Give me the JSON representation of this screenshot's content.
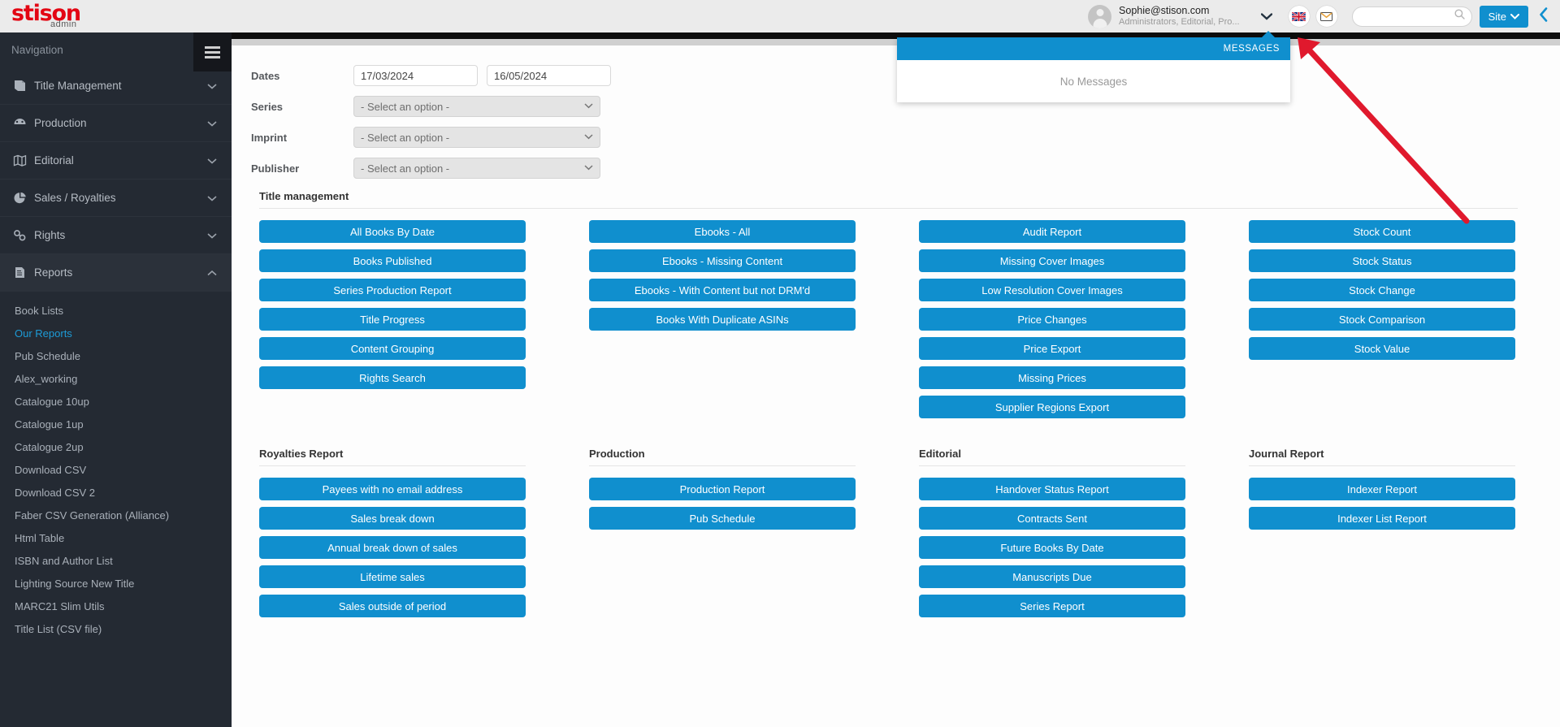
{
  "brand": {
    "name": "stison",
    "sub": "admin"
  },
  "header": {
    "user_email": "Sophie@stison.com",
    "user_roles": "Administrators, Editorial, Pro...",
    "user_chevron": "❯",
    "language_icon": "uk-flag-icon",
    "messages_icon": "envelope-icon",
    "search_placeholder": "",
    "search_value": "",
    "search_icon": "search-icon",
    "site_label": "Site",
    "site_chevron": "❯",
    "collapse_chevron": "❮",
    "accent_color": "#108fce",
    "brand_color": "#e30613"
  },
  "messages_popup": {
    "title": "MESSAGES",
    "empty_text": "No Messages"
  },
  "sidebar": {
    "heading": "Navigation",
    "menu_icon": "hamburger-icon",
    "items": [
      {
        "label": "Title Management",
        "icon": "book-icon",
        "arrow": "⌄"
      },
      {
        "label": "Production",
        "icon": "gauge-icon",
        "arrow": "⌄"
      },
      {
        "label": "Editorial",
        "icon": "map-icon",
        "arrow": "⌄"
      },
      {
        "label": "Sales / Royalties",
        "icon": "pie-chart-icon",
        "arrow": "⌄"
      },
      {
        "label": "Rights",
        "icon": "link-icon",
        "arrow": "⌄"
      },
      {
        "label": "Reports",
        "icon": "document-icon",
        "arrow": "⌃"
      }
    ],
    "sub_items": [
      {
        "label": "Book Lists",
        "selected": false
      },
      {
        "label": "Our Reports",
        "selected": true
      },
      {
        "label": "Pub Schedule",
        "selected": false
      },
      {
        "label": "Alex_working",
        "selected": false
      },
      {
        "label": "Catalogue 10up",
        "selected": false
      },
      {
        "label": "Catalogue 1up",
        "selected": false
      },
      {
        "label": "Catalogue 2up",
        "selected": false
      },
      {
        "label": "Download CSV",
        "selected": false
      },
      {
        "label": "Download CSV 2",
        "selected": false
      },
      {
        "label": "Faber CSV Generation (Alliance)",
        "selected": false
      },
      {
        "label": "Html Table",
        "selected": false
      },
      {
        "label": "ISBN and Author List",
        "selected": false
      },
      {
        "label": "Lighting Source New Title",
        "selected": false
      },
      {
        "label": "MARC21 Slim Utils",
        "selected": false
      },
      {
        "label": "Title List (CSV file)",
        "selected": false
      }
    ]
  },
  "filters": {
    "dates_label": "Dates",
    "date_from": "17/03/2024",
    "date_to": "16/05/2024",
    "series_label": "Series",
    "series_value": "- Select an option -",
    "imprint_label": "Imprint",
    "imprint_value": "- Select an option -",
    "publisher_label": "Publisher",
    "publisher_value": "- Select an option -"
  },
  "sections": {
    "title_management": {
      "heading": "Title management",
      "columns": [
        [
          "All Books By Date",
          "Books Published",
          "Series Production Report",
          "Title Progress",
          "Content Grouping",
          "Rights Search"
        ],
        [
          "Ebooks - All",
          "Ebooks - Missing Content",
          "Ebooks - With Content but not DRM'd",
          "Books With Duplicate ASINs"
        ],
        [
          "Audit Report",
          "Missing Cover Images",
          "Low Resolution Cover Images",
          "Price Changes",
          "Price Export",
          "Missing Prices",
          "Supplier Regions Export"
        ],
        [
          "Stock Count",
          "Stock Status",
          "Stock Change",
          "Stock Comparison",
          "Stock Value"
        ]
      ]
    },
    "lower": {
      "headings": [
        "Royalties Report",
        "Production",
        "Editorial",
        "Journal Report"
      ],
      "columns": [
        [
          "Payees with no email address",
          "Sales break down",
          "Annual break down of sales",
          "Lifetime sales",
          "Sales outside of period"
        ],
        [
          "Production Report",
          "Pub Schedule"
        ],
        [
          "Handover Status Report",
          "Contracts Sent",
          "Future Books By Date",
          "Manuscripts Due",
          "Series Report"
        ],
        [
          "Indexer Report",
          "Indexer List Report"
        ]
      ]
    }
  },
  "annotation": {
    "arrow_color": "#e0192d",
    "arrow_name": "pointer-arrow"
  }
}
